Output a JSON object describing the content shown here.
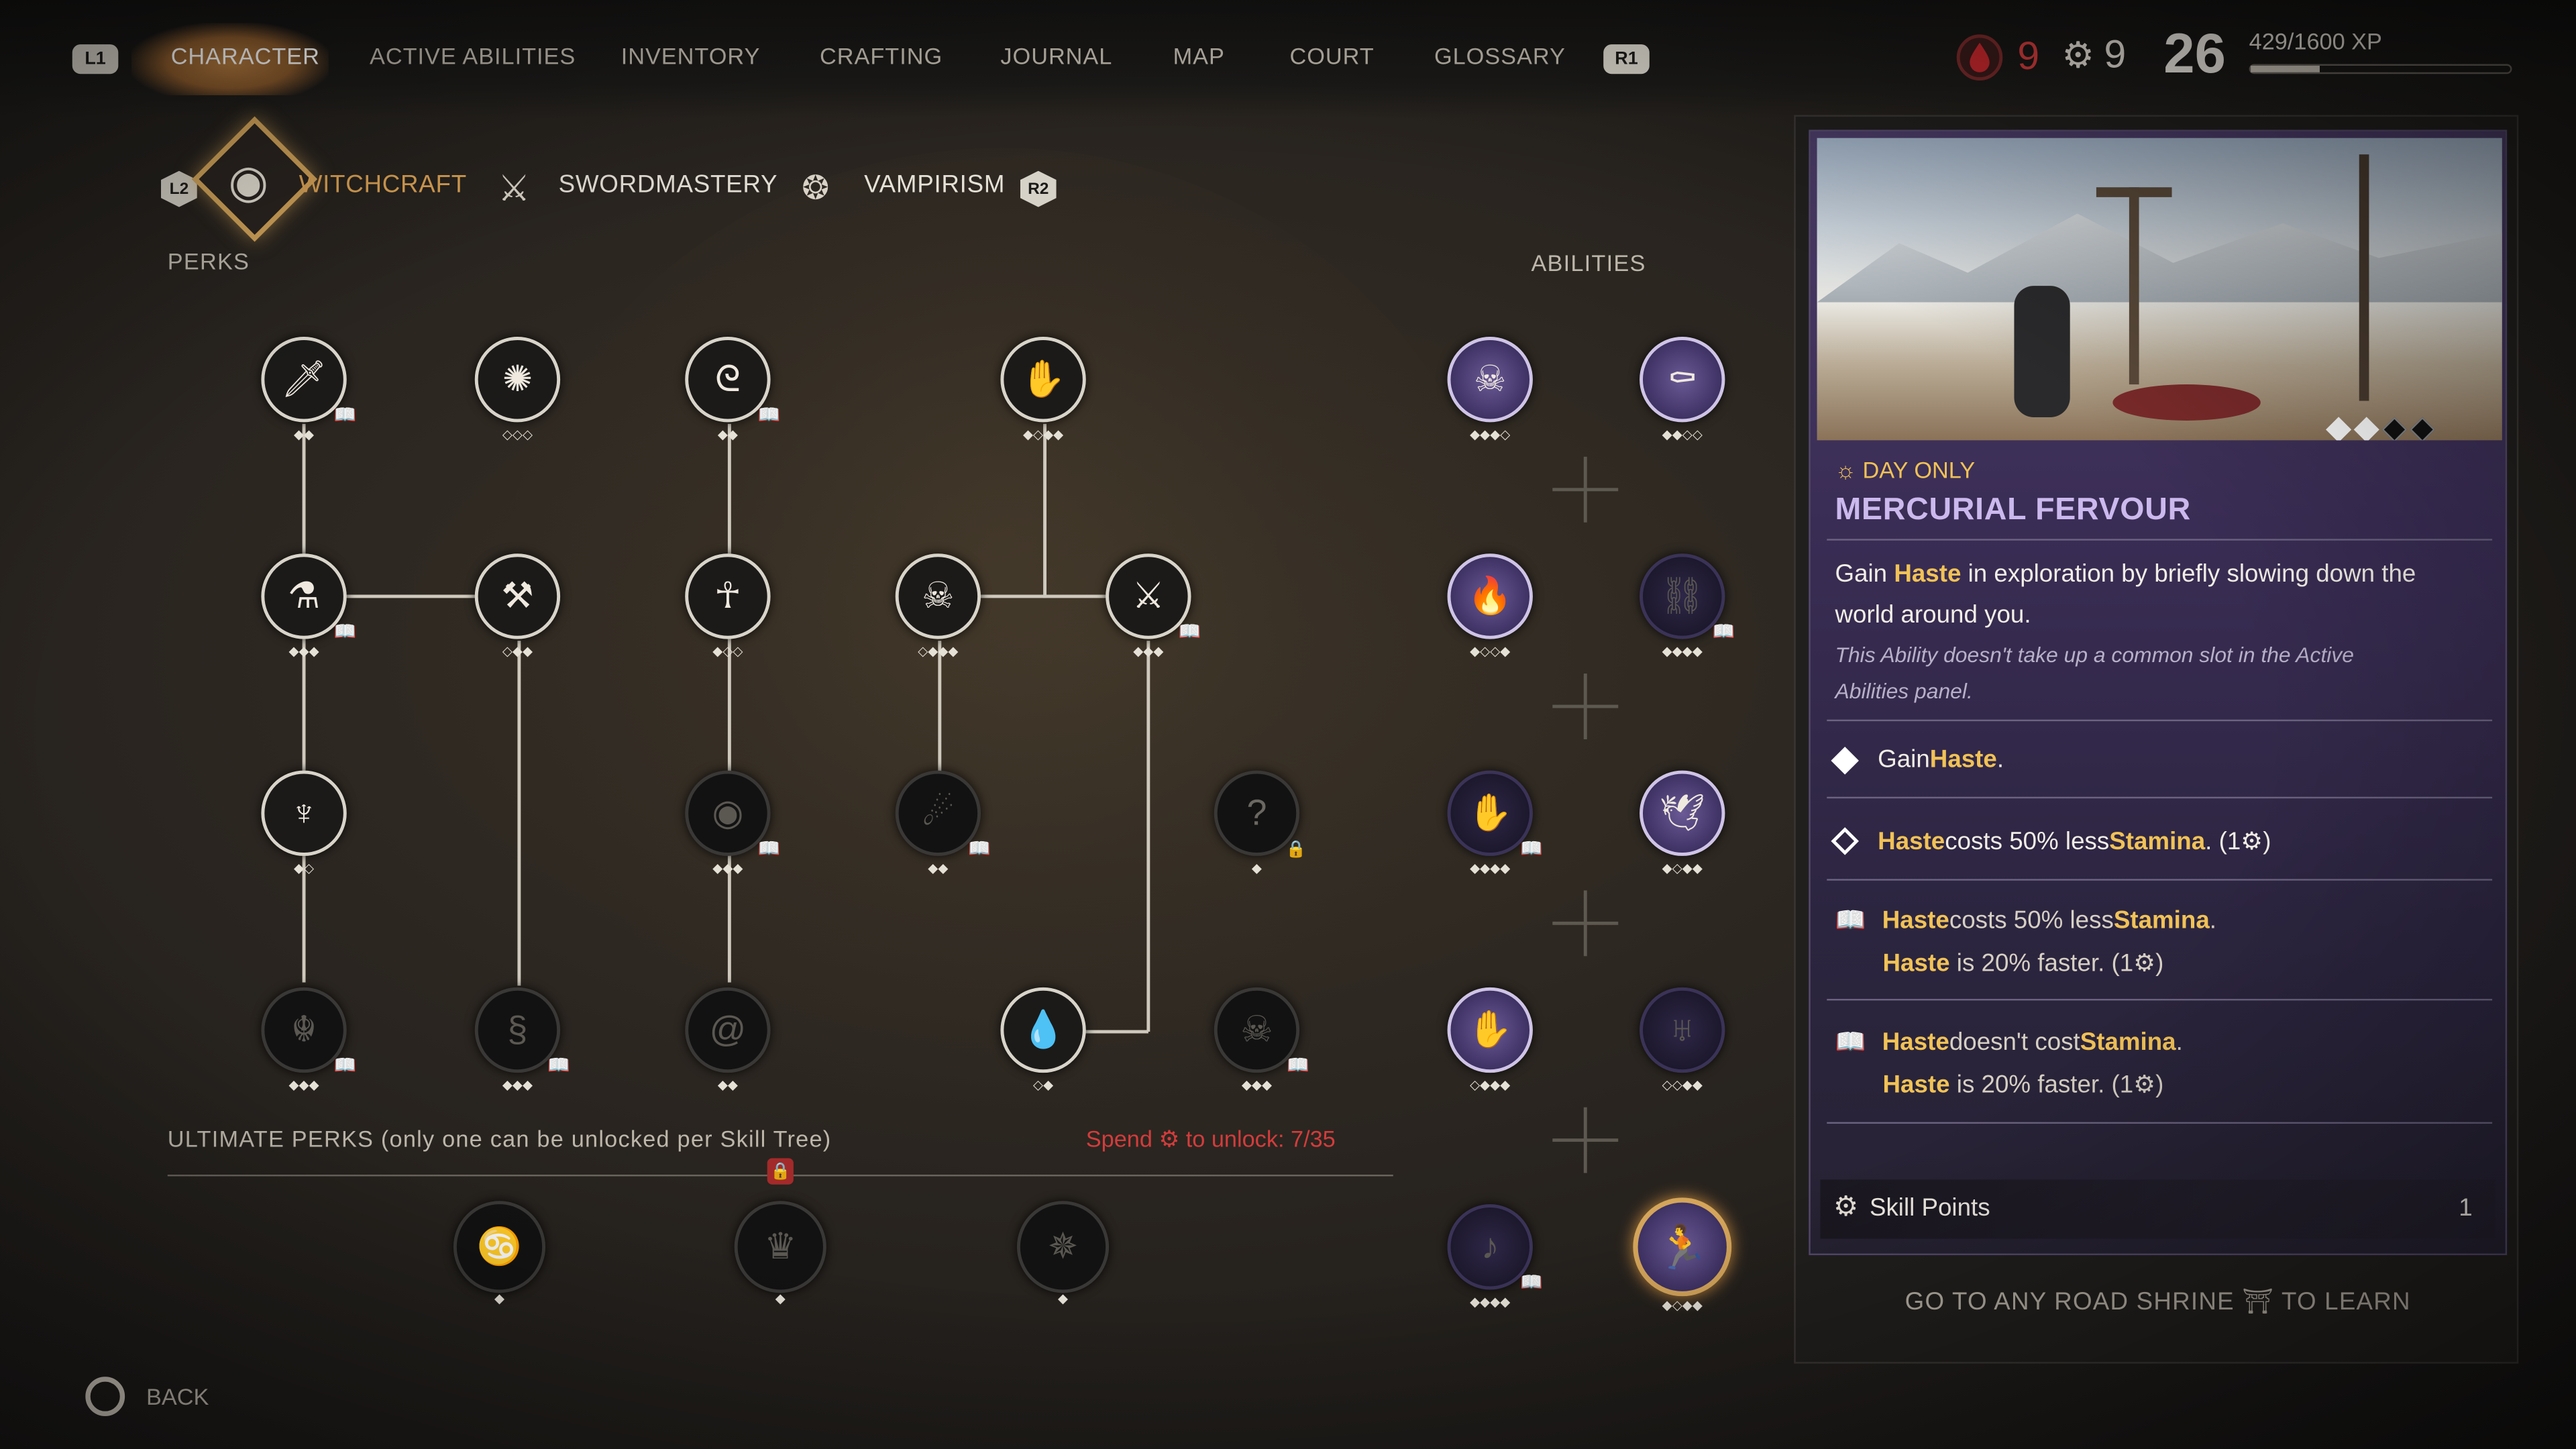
{
  "nav": {
    "left_button": "L1",
    "right_button": "R1",
    "tabs": [
      "CHARACTER",
      "ACTIVE ABILITIES",
      "INVENTORY",
      "CRAFTING",
      "JOURNAL",
      "MAP",
      "COURT",
      "GLOSSARY"
    ],
    "active": "CHARACTER"
  },
  "stats": {
    "blood": "9",
    "skill_points": "9",
    "level": "26",
    "xp": "429/1600 XP",
    "xp_progress": 0.268
  },
  "subtabs": {
    "left_button": "L2",
    "right_button": "R2",
    "items": [
      "WITCHCRAFT",
      "SWORDMASTERY",
      "VAMPIRISM"
    ],
    "active": "WITCHCRAFT"
  },
  "sections": {
    "perks": "PERKS",
    "abilities": "ABILITIES",
    "ultimate": "ULTIMATE PERKS (only one can be unlocked per Skill Tree)",
    "spend_prefix": "Spend",
    "spend_suffix": "to unlock: 7/35"
  },
  "tree": {
    "question_mark": "?"
  },
  "details": {
    "tag": "DAY ONLY",
    "title": "MERCURIAL FERVOUR",
    "desc_a": "Gain ",
    "desc_hl": "Haste",
    "desc_b": " in exploration by briefly slowing down the",
    "desc_line2": "world around you.",
    "note_line1": "This Ability doesn't take up a common slot in the Active",
    "note_line2": "Abilities panel.",
    "tier1_a": "Gain ",
    "tier1_hl": "Haste",
    "tier1_b": ".",
    "tier2_hl1": "Haste",
    "tier2_mid": " costs 50% less ",
    "tier2_hl2": "Stamina",
    "tier2_end": ".  (1",
    "tier3_hl1": "Haste",
    "tier3_mid": " costs 50% less ",
    "tier3_hl2": "Stamina",
    "tier3_end": ".",
    "tier3_line2_hl": "Haste",
    "tier3_line2": " is 20% faster.  (1",
    "tier4_hl1": "Haste",
    "tier4_mid": " doesn't cost ",
    "tier4_hl2": "Stamina",
    "tier4_end": ".",
    "tier4_line2_hl": "Haste",
    "tier4_line2": " is 20% faster.  (1",
    "close_paren": ")",
    "skill_points_label": "Skill Points",
    "skill_points_value": "1",
    "shrine_a": "GO TO ANY ROAD SHRINE",
    "shrine_b": "TO LEARN"
  },
  "back": "BACK"
}
